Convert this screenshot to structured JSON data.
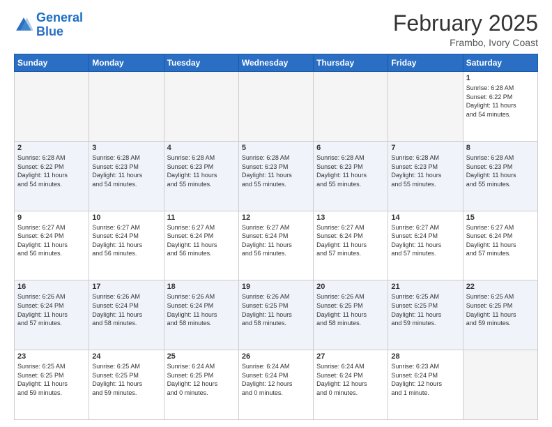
{
  "header": {
    "logo_line1": "General",
    "logo_line2": "Blue",
    "month_title": "February 2025",
    "location": "Frambo, Ivory Coast"
  },
  "weekdays": [
    "Sunday",
    "Monday",
    "Tuesday",
    "Wednesday",
    "Thursday",
    "Friday",
    "Saturday"
  ],
  "weeks": [
    [
      {
        "day": "",
        "info": ""
      },
      {
        "day": "",
        "info": ""
      },
      {
        "day": "",
        "info": ""
      },
      {
        "day": "",
        "info": ""
      },
      {
        "day": "",
        "info": ""
      },
      {
        "day": "",
        "info": ""
      },
      {
        "day": "1",
        "info": "Sunrise: 6:28 AM\nSunset: 6:22 PM\nDaylight: 11 hours\nand 54 minutes."
      }
    ],
    [
      {
        "day": "2",
        "info": "Sunrise: 6:28 AM\nSunset: 6:22 PM\nDaylight: 11 hours\nand 54 minutes."
      },
      {
        "day": "3",
        "info": "Sunrise: 6:28 AM\nSunset: 6:23 PM\nDaylight: 11 hours\nand 54 minutes."
      },
      {
        "day": "4",
        "info": "Sunrise: 6:28 AM\nSunset: 6:23 PM\nDaylight: 11 hours\nand 55 minutes."
      },
      {
        "day": "5",
        "info": "Sunrise: 6:28 AM\nSunset: 6:23 PM\nDaylight: 11 hours\nand 55 minutes."
      },
      {
        "day": "6",
        "info": "Sunrise: 6:28 AM\nSunset: 6:23 PM\nDaylight: 11 hours\nand 55 minutes."
      },
      {
        "day": "7",
        "info": "Sunrise: 6:28 AM\nSunset: 6:23 PM\nDaylight: 11 hours\nand 55 minutes."
      },
      {
        "day": "8",
        "info": "Sunrise: 6:28 AM\nSunset: 6:23 PM\nDaylight: 11 hours\nand 55 minutes."
      }
    ],
    [
      {
        "day": "9",
        "info": "Sunrise: 6:27 AM\nSunset: 6:24 PM\nDaylight: 11 hours\nand 56 minutes."
      },
      {
        "day": "10",
        "info": "Sunrise: 6:27 AM\nSunset: 6:24 PM\nDaylight: 11 hours\nand 56 minutes."
      },
      {
        "day": "11",
        "info": "Sunrise: 6:27 AM\nSunset: 6:24 PM\nDaylight: 11 hours\nand 56 minutes."
      },
      {
        "day": "12",
        "info": "Sunrise: 6:27 AM\nSunset: 6:24 PM\nDaylight: 11 hours\nand 56 minutes."
      },
      {
        "day": "13",
        "info": "Sunrise: 6:27 AM\nSunset: 6:24 PM\nDaylight: 11 hours\nand 57 minutes."
      },
      {
        "day": "14",
        "info": "Sunrise: 6:27 AM\nSunset: 6:24 PM\nDaylight: 11 hours\nand 57 minutes."
      },
      {
        "day": "15",
        "info": "Sunrise: 6:27 AM\nSunset: 6:24 PM\nDaylight: 11 hours\nand 57 minutes."
      }
    ],
    [
      {
        "day": "16",
        "info": "Sunrise: 6:26 AM\nSunset: 6:24 PM\nDaylight: 11 hours\nand 57 minutes."
      },
      {
        "day": "17",
        "info": "Sunrise: 6:26 AM\nSunset: 6:24 PM\nDaylight: 11 hours\nand 58 minutes."
      },
      {
        "day": "18",
        "info": "Sunrise: 6:26 AM\nSunset: 6:24 PM\nDaylight: 11 hours\nand 58 minutes."
      },
      {
        "day": "19",
        "info": "Sunrise: 6:26 AM\nSunset: 6:25 PM\nDaylight: 11 hours\nand 58 minutes."
      },
      {
        "day": "20",
        "info": "Sunrise: 6:26 AM\nSunset: 6:25 PM\nDaylight: 11 hours\nand 58 minutes."
      },
      {
        "day": "21",
        "info": "Sunrise: 6:25 AM\nSunset: 6:25 PM\nDaylight: 11 hours\nand 59 minutes."
      },
      {
        "day": "22",
        "info": "Sunrise: 6:25 AM\nSunset: 6:25 PM\nDaylight: 11 hours\nand 59 minutes."
      }
    ],
    [
      {
        "day": "23",
        "info": "Sunrise: 6:25 AM\nSunset: 6:25 PM\nDaylight: 11 hours\nand 59 minutes."
      },
      {
        "day": "24",
        "info": "Sunrise: 6:25 AM\nSunset: 6:25 PM\nDaylight: 11 hours\nand 59 minutes."
      },
      {
        "day": "25",
        "info": "Sunrise: 6:24 AM\nSunset: 6:25 PM\nDaylight: 12 hours\nand 0 minutes."
      },
      {
        "day": "26",
        "info": "Sunrise: 6:24 AM\nSunset: 6:24 PM\nDaylight: 12 hours\nand 0 minutes."
      },
      {
        "day": "27",
        "info": "Sunrise: 6:24 AM\nSunset: 6:24 PM\nDaylight: 12 hours\nand 0 minutes."
      },
      {
        "day": "28",
        "info": "Sunrise: 6:23 AM\nSunset: 6:24 PM\nDaylight: 12 hours\nand 1 minute."
      },
      {
        "day": "",
        "info": ""
      }
    ]
  ]
}
